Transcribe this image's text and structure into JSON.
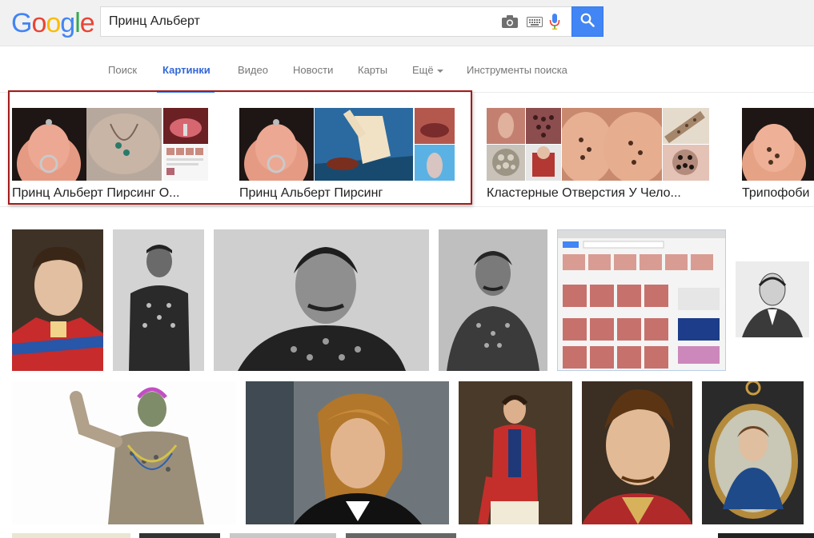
{
  "search": {
    "query": "Принц Альберт"
  },
  "nav": {
    "items": [
      {
        "label": "Поиск"
      },
      {
        "label": "Картинки"
      },
      {
        "label": "Видео"
      },
      {
        "label": "Новости"
      },
      {
        "label": "Карты"
      },
      {
        "label": "Ещё"
      },
      {
        "label": "Инструменты поиска"
      }
    ]
  },
  "related": [
    {
      "label": "Принц Альберт Пирсинг О..."
    },
    {
      "label": "Принц Альберт Пирсинг"
    },
    {
      "label": "Кластерные Отверстия У Чело..."
    },
    {
      "label": "Трипофоби"
    }
  ],
  "colors": {
    "accent": "#4285f4",
    "highlight_border": "#a51b1b",
    "active_tab": "#3367d6"
  },
  "icons": [
    "camera-icon",
    "keyboard-icon",
    "microphone-icon",
    "search-icon"
  ]
}
